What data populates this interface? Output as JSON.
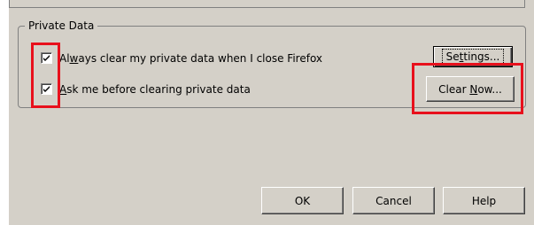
{
  "private_data": {
    "group_title": "Private Data",
    "always_clear": {
      "label_pre": "Al",
      "label_accel": "w",
      "label_post": "ays clear my private data when I close Firefox",
      "checked": true
    },
    "ask_before": {
      "label_pre": "",
      "label_accel": "A",
      "label_post": "sk me before clearing private data",
      "checked": true
    },
    "settings_button": {
      "label_pre": "Se",
      "label_accel": "t",
      "label_post": "tings..."
    },
    "clear_now_button": {
      "label_pre": "Clear ",
      "label_accel": "N",
      "label_post": "ow..."
    }
  },
  "footer": {
    "ok_label": "OK",
    "cancel_label": "Cancel",
    "help_label": "Help"
  },
  "highlight_color": "#e8101c",
  "dialog_background": "#d4d0c8"
}
